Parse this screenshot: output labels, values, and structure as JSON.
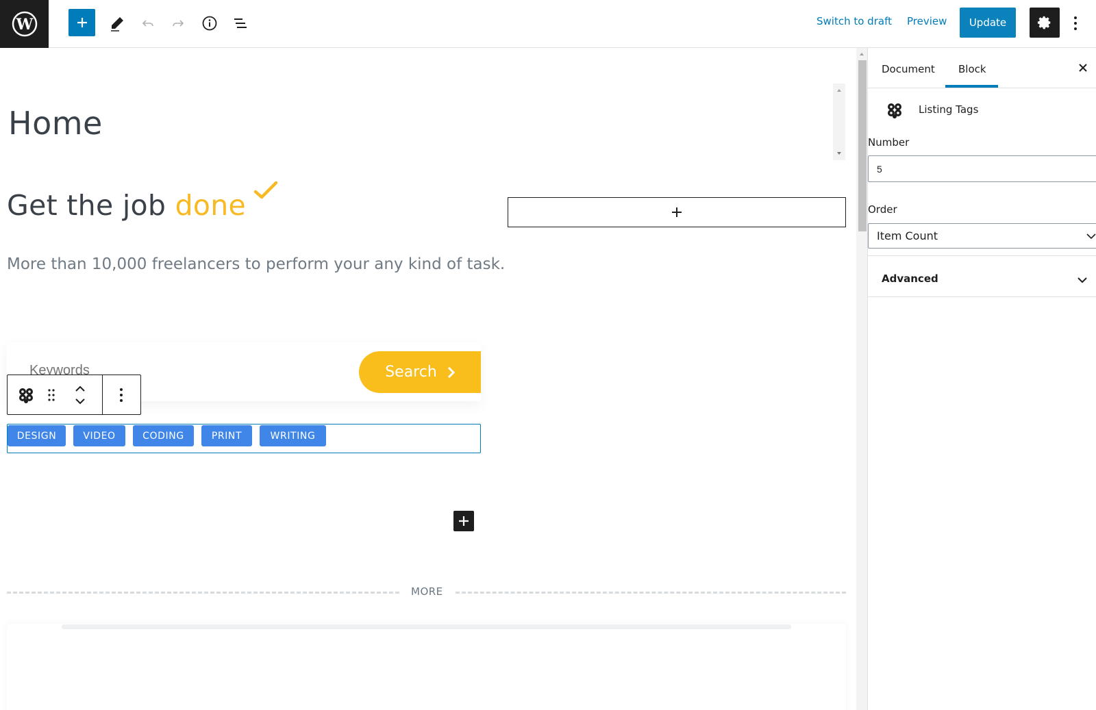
{
  "toolbar": {
    "switch_to_draft": "Switch to draft",
    "preview": "Preview",
    "update": "Update",
    "icons": [
      "wordpress-logo",
      "plus",
      "pencil",
      "undo",
      "redo",
      "info",
      "list-view",
      "gear",
      "vertical-ellipsis"
    ]
  },
  "editor": {
    "page_title": "Home",
    "heading_main": "Get the job ",
    "heading_accent": "done",
    "subtext": "More than 10,000 freelancers to perform your any kind of task.",
    "search_placeholder": "Keywords",
    "search_button": "Search",
    "tags": [
      "DESIGN",
      "VIDEO",
      "CODING",
      "PRINT",
      "WRITING"
    ],
    "more_label": "MORE"
  },
  "sidebar": {
    "tabs": [
      "Document",
      "Block"
    ],
    "active_tab": "Block",
    "block_name": "Listing Tags",
    "number_label": "Number",
    "number_value": "5",
    "order_label": "Order",
    "order_value": "Item Count",
    "advanced_label": "Advanced"
  },
  "colors": {
    "accent_blue": "#007cba",
    "tag_blue": "#3f86e8",
    "search_yellow": "#f9be1c",
    "heading_accent": "#f7b924",
    "dark": "#1e1e1e"
  }
}
